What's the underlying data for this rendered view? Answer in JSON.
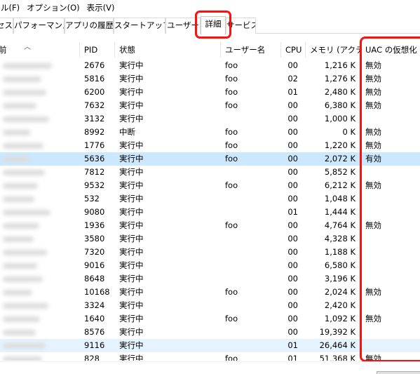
{
  "menubar": {
    "items": [
      "ル(F)",
      "オプション(O)",
      "表示(V)"
    ]
  },
  "tabs": [
    {
      "label": "セス",
      "active": false
    },
    {
      "label": "パフォーマンス",
      "active": false
    },
    {
      "label": "アプリの履歴",
      "active": false
    },
    {
      "label": "スタートアップ",
      "active": false
    },
    {
      "label": "ユーザー",
      "active": false
    },
    {
      "label": "詳細",
      "active": true
    },
    {
      "label": "サービス",
      "active": false
    }
  ],
  "columns": {
    "name": "前",
    "pid": "PID",
    "status": "状態",
    "user": "ユーザー名",
    "cpu": "CPU",
    "memory": "メモリ (アクティ...",
    "uac": "UAC の仮想化"
  },
  "rows": [
    {
      "pid": "2676",
      "status": "実行中",
      "user": "foo",
      "cpu": "00",
      "memory": "1,216 K",
      "uac": "無効"
    },
    {
      "pid": "5816",
      "status": "実行中",
      "user": "foo",
      "cpu": "02",
      "memory": "1,276 K",
      "uac": "無効"
    },
    {
      "pid": "6200",
      "status": "実行中",
      "user": "foo",
      "cpu": "01",
      "memory": "2,480 K",
      "uac": "無効"
    },
    {
      "pid": "7632",
      "status": "実行中",
      "user": "foo",
      "cpu": "00",
      "memory": "6,380 K",
      "uac": "無効"
    },
    {
      "pid": "3132",
      "status": "実行中",
      "user": "",
      "cpu": "00",
      "memory": "1,000 K",
      "uac": ""
    },
    {
      "pid": "8992",
      "status": "中断",
      "user": "foo",
      "cpu": "00",
      "memory": "0 K",
      "uac": "無効"
    },
    {
      "pid": "1776",
      "status": "実行中",
      "user": "foo",
      "cpu": "00",
      "memory": "1,220 K",
      "uac": "無効"
    },
    {
      "pid": "5636",
      "status": "実行中",
      "user": "foo",
      "cpu": "00",
      "memory": "2,072 K",
      "uac": "有効",
      "selected": true
    },
    {
      "pid": "7812",
      "status": "実行中",
      "user": "",
      "cpu": "00",
      "memory": "5,852 K",
      "uac": ""
    },
    {
      "pid": "9532",
      "status": "実行中",
      "user": "foo",
      "cpu": "00",
      "memory": "6,212 K",
      "uac": "無効"
    },
    {
      "pid": "532",
      "status": "実行中",
      "user": "",
      "cpu": "00",
      "memory": "1,048 K",
      "uac": ""
    },
    {
      "pid": "9080",
      "status": "実行中",
      "user": "",
      "cpu": "01",
      "memory": "1,444 K",
      "uac": ""
    },
    {
      "pid": "1936",
      "status": "実行中",
      "user": "foo",
      "cpu": "00",
      "memory": "4,764 K",
      "uac": "無効"
    },
    {
      "pid": "3580",
      "status": "実行中",
      "user": "",
      "cpu": "00",
      "memory": "4,328 K",
      "uac": ""
    },
    {
      "pid": "7320",
      "status": "実行中",
      "user": "",
      "cpu": "00",
      "memory": "1,188 K",
      "uac": ""
    },
    {
      "pid": "9016",
      "status": "実行中",
      "user": "",
      "cpu": "00",
      "memory": "6,580 K",
      "uac": ""
    },
    {
      "pid": "8648",
      "status": "実行中",
      "user": "",
      "cpu": "00",
      "memory": "3,196 K",
      "uac": ""
    },
    {
      "pid": "10168",
      "status": "実行中",
      "user": "foo",
      "cpu": "00",
      "memory": "2,024 K",
      "uac": "無効"
    },
    {
      "pid": "3324",
      "status": "実行中",
      "user": "",
      "cpu": "00",
      "memory": "2,420 K",
      "uac": ""
    },
    {
      "pid": "1640",
      "status": "実行中",
      "user": "foo",
      "cpu": "00",
      "memory": "1,092 K",
      "uac": "無効"
    },
    {
      "pid": "8576",
      "status": "実行中",
      "user": "",
      "cpu": "00",
      "memory": "19,392 K",
      "uac": ""
    },
    {
      "pid": "9116",
      "status": "実行中",
      "user": "",
      "cpu": "01",
      "memory": "26,464 K",
      "uac": "",
      "hover": true
    },
    {
      "pid": "828",
      "status": "実行中",
      "user": "foo",
      "cpu": "01",
      "memory": "51,368 K",
      "uac": "無効"
    }
  ],
  "colors": {
    "highlight": "#ff1010",
    "selected_row": "#cce8ff",
    "hover_row": "#e5f3ff"
  }
}
